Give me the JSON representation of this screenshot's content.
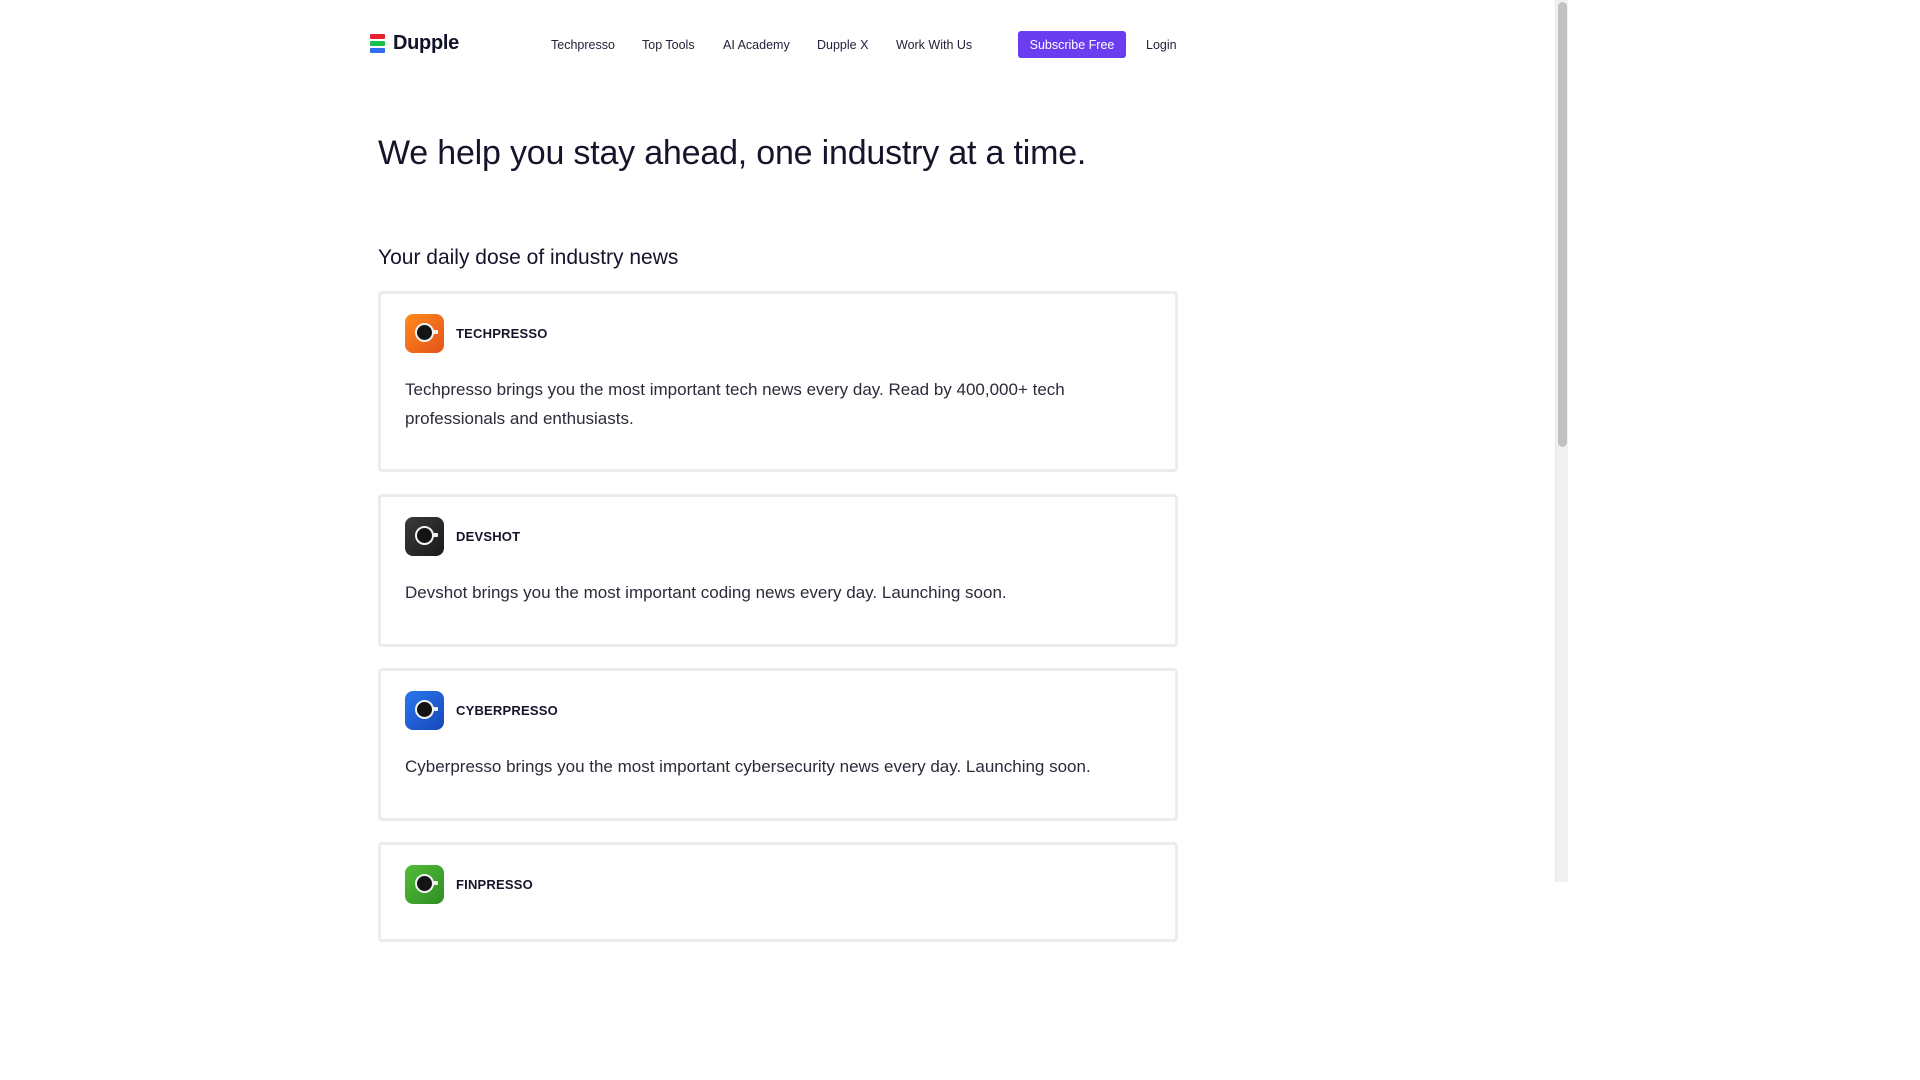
{
  "brand": {
    "name": "Dupple",
    "logo_colors": [
      "#e8212e",
      "#17c24a",
      "#2f6ff0"
    ]
  },
  "nav": {
    "items": [
      {
        "label": "Techpresso"
      },
      {
        "label": "Top Tools"
      },
      {
        "label": "AI Academy"
      },
      {
        "label": "Dupple X"
      },
      {
        "label": "Work With Us"
      }
    ],
    "subscribe_label": "Subscribe Free",
    "login_label": "Login"
  },
  "hero": {
    "title": "We help you stay ahead, one industry at a time."
  },
  "section": {
    "title": "Your daily dose of industry news"
  },
  "newsletters": [
    {
      "name": "TECHPRESSO",
      "description": "Techpresso brings you the most important tech news every day. Read by 400,000+ tech professionals and enthusiasts.",
      "icon": "coffee-cup-icon",
      "color": "#f26a1b"
    },
    {
      "name": "DEVSHOT",
      "description": "Devshot brings you the most important coding news every day. Launching soon.",
      "icon": "coffee-cup-icon",
      "color": "#2a2a2a"
    },
    {
      "name": "CYBERPRESSO",
      "description": "Cyberpresso brings you the most important cybersecurity news every day. Launching soon.",
      "icon": "coffee-cup-icon",
      "color": "#1f5fd6"
    },
    {
      "name": "FINPRESSO",
      "description": "",
      "icon": "coffee-cup-icon",
      "color": "#3ea82f"
    }
  ]
}
